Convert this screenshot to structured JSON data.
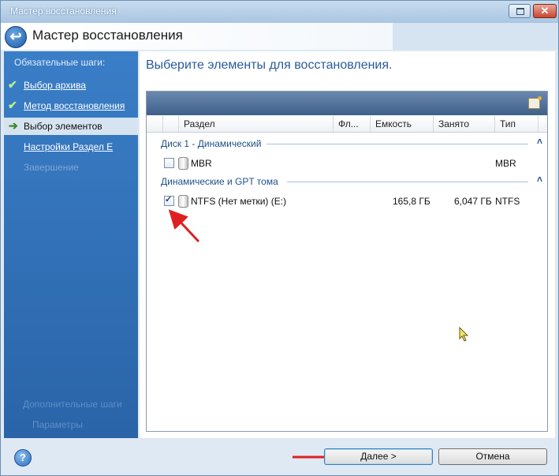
{
  "window": {
    "title": "Мастер восстановления"
  },
  "header": {
    "title": "Мастер восстановления",
    "back_glyph": "↩"
  },
  "sidebar": {
    "heading": "Обязательные шаги:",
    "items": [
      {
        "label": "Выбор архива",
        "state": "done",
        "icon": "check-icon"
      },
      {
        "label": "Метод восстановления",
        "state": "done",
        "icon": "check-icon"
      },
      {
        "label": "Выбор элементов",
        "state": "current",
        "icon": "arrow-right-icon"
      },
      {
        "label": "Настройки Раздел E",
        "state": "pending"
      },
      {
        "label": "Завершение",
        "state": "disabled"
      }
    ],
    "optional_heading": "Дополнительные шаги",
    "optional_item": "Параметры"
  },
  "main": {
    "title": "Выберите элементы для восстановления.",
    "columns": [
      "Раздел",
      "Фл...",
      "Емкость",
      "Занято",
      "Тип"
    ],
    "groups": [
      {
        "label": "Диск 1 - Динамический",
        "rows": [
          {
            "name": "MBR",
            "flags": "",
            "capacity": "",
            "used": "",
            "type": "MBR",
            "checked": false
          }
        ]
      },
      {
        "label": "Динамические и GPT тома",
        "rows": [
          {
            "name": "NTFS (Нет метки) (E:)",
            "flags": "",
            "capacity": "165,8 ГБ",
            "used": "6,047 ГБ",
            "type": "NTFS",
            "checked": true
          }
        ]
      }
    ]
  },
  "buttons": {
    "next": "Далее >",
    "cancel": "Отмена",
    "help": "?"
  },
  "colors": {
    "sidebar": "#3a7ec7",
    "accent": "#2a5b9c",
    "arrow": "#e02020"
  }
}
